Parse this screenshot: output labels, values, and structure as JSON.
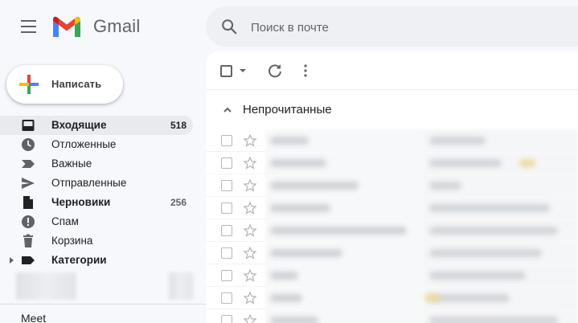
{
  "app": {
    "brand": "Gmail"
  },
  "search": {
    "placeholder": "Поиск в почте"
  },
  "compose": {
    "label": "Написать"
  },
  "sidebar": {
    "items": [
      {
        "id": "inbox",
        "label": "Входящие",
        "count": "518",
        "icon": "inbox-icon",
        "bold": true,
        "active": true
      },
      {
        "id": "snoozed",
        "label": "Отложенные",
        "count": "",
        "icon": "clock-icon",
        "bold": false
      },
      {
        "id": "important",
        "label": "Важные",
        "count": "",
        "icon": "label-important-icon",
        "bold": false
      },
      {
        "id": "sent",
        "label": "Отправленные",
        "count": "",
        "icon": "send-icon",
        "bold": false
      },
      {
        "id": "drafts",
        "label": "Черновики",
        "count": "256",
        "icon": "draft-icon",
        "bold": true
      },
      {
        "id": "spam",
        "label": "Спам",
        "count": "",
        "icon": "spam-icon",
        "bold": false
      },
      {
        "id": "trash",
        "label": "Корзина",
        "count": "",
        "icon": "trash-icon",
        "bold": false
      },
      {
        "id": "categories",
        "label": "Категории",
        "count": "",
        "icon": "label-icon",
        "bold": true
      }
    ],
    "meet_label": "Meet"
  },
  "main": {
    "section_title": "Непрочитанные",
    "row_count": 9
  },
  "colors": {
    "accent_red": "#ea4335",
    "accent_blue": "#4285f4",
    "accent_green": "#34a853",
    "accent_yellow": "#fbbc04",
    "icon_gray": "#5f6368",
    "active_bg": "#e8eaed"
  }
}
